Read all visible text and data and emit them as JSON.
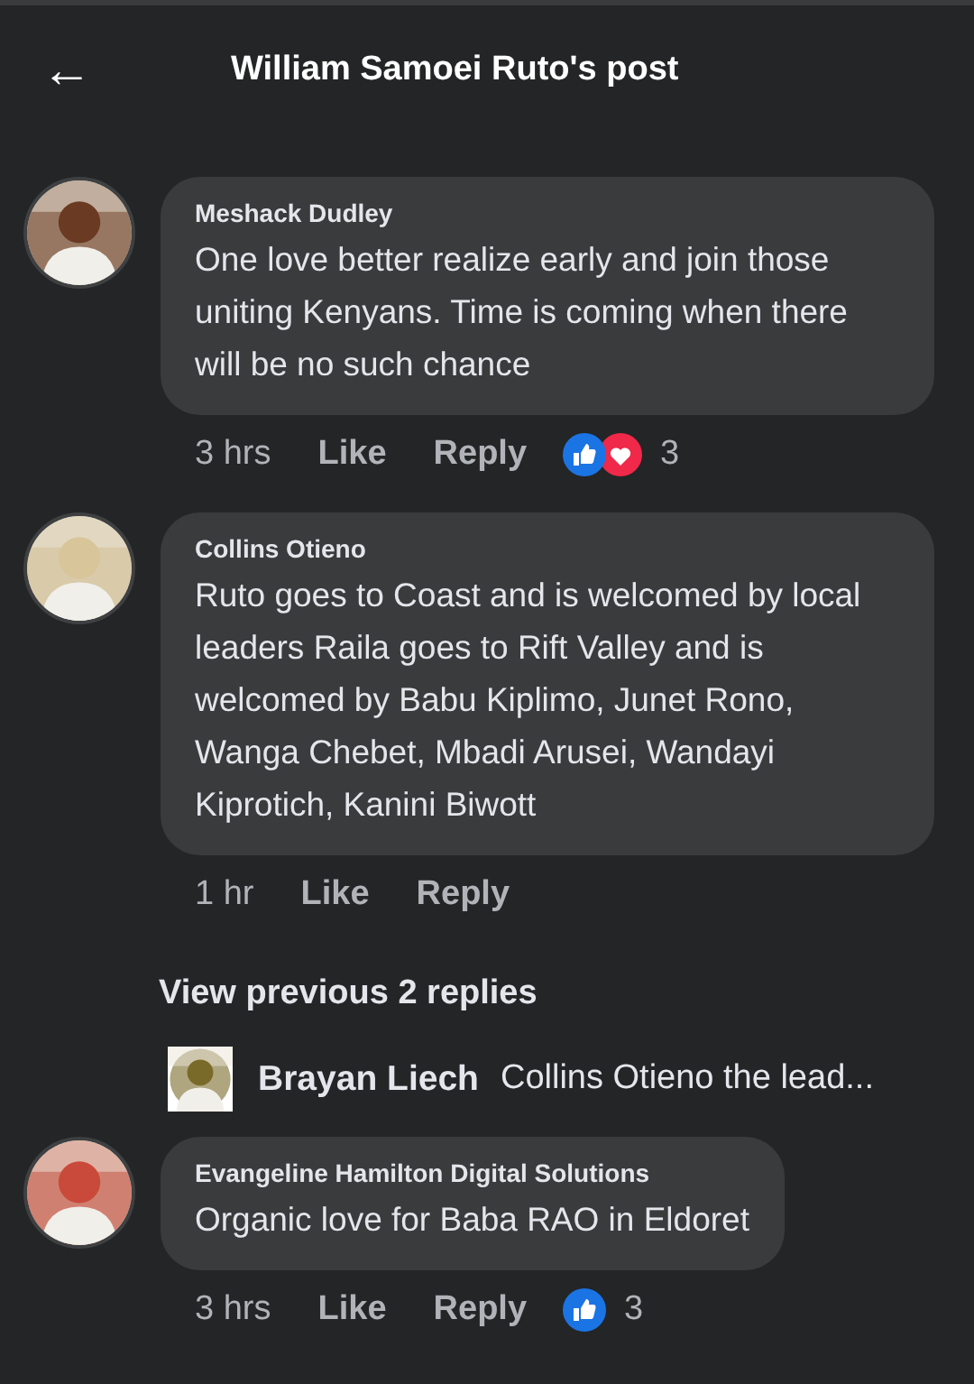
{
  "header": {
    "back": "←",
    "title": "William Samoei Ruto's post"
  },
  "comments": [
    {
      "author": "Meshack Dudley",
      "text": "One love better realize early and join those uniting Kenyans. Time is coming when there will be no such chance",
      "time": "3 hrs",
      "like": "Like",
      "reply": "Reply",
      "reactions": [
        {
          "kind": "like"
        },
        {
          "kind": "love"
        }
      ],
      "reaction_count": "3",
      "avatar": {
        "kind": "picture",
        "color": "#6b3a22"
      }
    },
    {
      "author": "Collins Otieno",
      "text": "Ruto goes to Coast and is welcomed by local leaders Raila goes to Rift Valley and is welcomed by Babu Kiplimo, Junet  Rono, Wanga Chebet, Mbadi Arusei, Wandayi Kiprotich, Kanini Biwott",
      "time": "1 hr",
      "like": "Like",
      "reply": "Reply",
      "avatar": {
        "kind": "picture",
        "color": "#d8c59a"
      },
      "replies": {
        "view_more": "View previous 2 replies",
        "latest": {
          "author": "Brayan Liech",
          "text": "Collins Otieno the lead..."
        }
      }
    },
    {
      "author": "Evangeline Hamilton Digital Solutions",
      "text": "Organic love for Baba RAO in Eldoret",
      "time": "3 hrs",
      "like": "Like",
      "reply": "Reply",
      "reactions": [
        {
          "kind": "like"
        }
      ],
      "reaction_count": "3",
      "avatar": {
        "kind": "picture",
        "color": "#c94a3a"
      }
    }
  ]
}
